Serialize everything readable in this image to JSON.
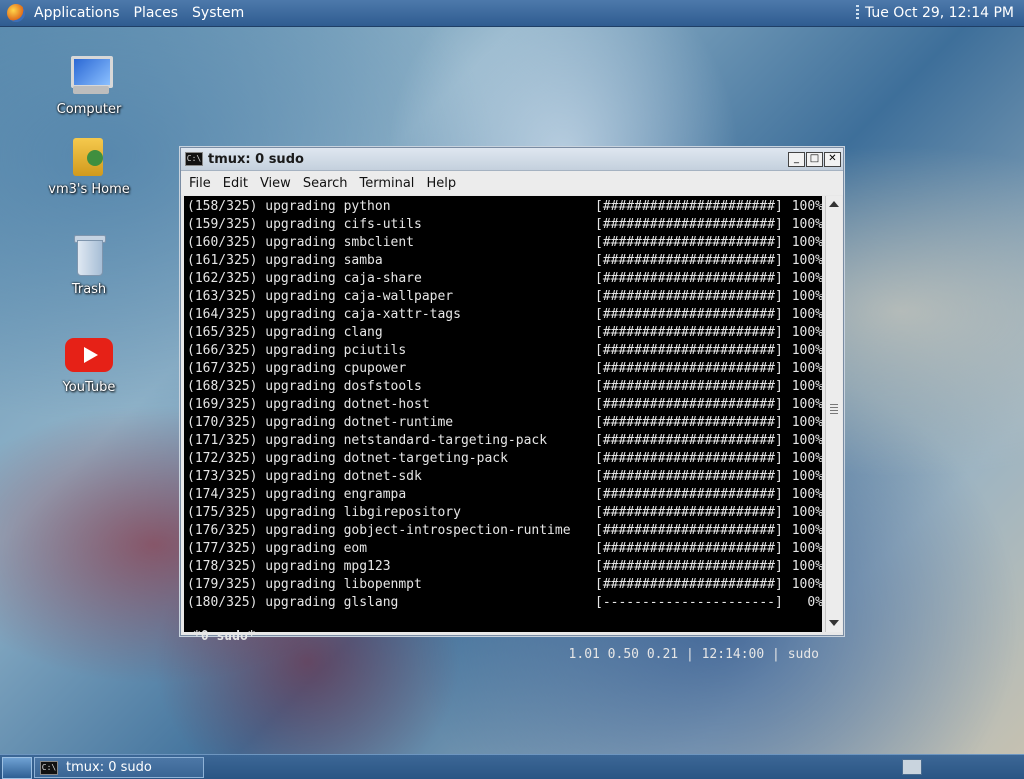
{
  "top_panel": {
    "menus": [
      "Applications",
      "Places",
      "System"
    ],
    "clock": "Tue Oct 29, 12:14 PM"
  },
  "desktop_icons": [
    {
      "label": "Computer",
      "icon": "computer-icon"
    },
    {
      "label": "vm3's Home",
      "icon": "home-folder-icon"
    },
    {
      "label": "Trash",
      "icon": "trash-icon"
    },
    {
      "label": "YouTube",
      "icon": "youtube-icon"
    }
  ],
  "window": {
    "title": "tmux: 0 sudo",
    "controls": [
      "minimize",
      "maximize",
      "close"
    ],
    "menu": [
      "File",
      "Edit",
      "View",
      "Search",
      "Terminal",
      "Help"
    ]
  },
  "terminal": {
    "lines": [
      {
        "counter": "(158/325)",
        "action": "upgrading",
        "pkg": "python",
        "bar": "[######################]",
        "pct": "100%"
      },
      {
        "counter": "(159/325)",
        "action": "upgrading",
        "pkg": "cifs-utils",
        "bar": "[######################]",
        "pct": "100%"
      },
      {
        "counter": "(160/325)",
        "action": "upgrading",
        "pkg": "smbclient",
        "bar": "[######################]",
        "pct": "100%"
      },
      {
        "counter": "(161/325)",
        "action": "upgrading",
        "pkg": "samba",
        "bar": "[######################]",
        "pct": "100%"
      },
      {
        "counter": "(162/325)",
        "action": "upgrading",
        "pkg": "caja-share",
        "bar": "[######################]",
        "pct": "100%"
      },
      {
        "counter": "(163/325)",
        "action": "upgrading",
        "pkg": "caja-wallpaper",
        "bar": "[######################]",
        "pct": "100%"
      },
      {
        "counter": "(164/325)",
        "action": "upgrading",
        "pkg": "caja-xattr-tags",
        "bar": "[######################]",
        "pct": "100%"
      },
      {
        "counter": "(165/325)",
        "action": "upgrading",
        "pkg": "clang",
        "bar": "[######################]",
        "pct": "100%"
      },
      {
        "counter": "(166/325)",
        "action": "upgrading",
        "pkg": "pciutils",
        "bar": "[######################]",
        "pct": "100%"
      },
      {
        "counter": "(167/325)",
        "action": "upgrading",
        "pkg": "cpupower",
        "bar": "[######################]",
        "pct": "100%"
      },
      {
        "counter": "(168/325)",
        "action": "upgrading",
        "pkg": "dosfstools",
        "bar": "[######################]",
        "pct": "100%"
      },
      {
        "counter": "(169/325)",
        "action": "upgrading",
        "pkg": "dotnet-host",
        "bar": "[######################]",
        "pct": "100%"
      },
      {
        "counter": "(170/325)",
        "action": "upgrading",
        "pkg": "dotnet-runtime",
        "bar": "[######################]",
        "pct": "100%"
      },
      {
        "counter": "(171/325)",
        "action": "upgrading",
        "pkg": "netstandard-targeting-pack",
        "bar": "[######################]",
        "pct": "100%"
      },
      {
        "counter": "(172/325)",
        "action": "upgrading",
        "pkg": "dotnet-targeting-pack",
        "bar": "[######################]",
        "pct": "100%"
      },
      {
        "counter": "(173/325)",
        "action": "upgrading",
        "pkg": "dotnet-sdk",
        "bar": "[######################]",
        "pct": "100%"
      },
      {
        "counter": "(174/325)",
        "action": "upgrading",
        "pkg": "engrampa",
        "bar": "[######################]",
        "pct": "100%"
      },
      {
        "counter": "(175/325)",
        "action": "upgrading",
        "pkg": "libgirepository",
        "bar": "[######################]",
        "pct": "100%"
      },
      {
        "counter": "(176/325)",
        "action": "upgrading",
        "pkg": "gobject-introspection-runtime",
        "bar": "[######################]",
        "pct": "100%"
      },
      {
        "counter": "(177/325)",
        "action": "upgrading",
        "pkg": "eom",
        "bar": "[######################]",
        "pct": "100%"
      },
      {
        "counter": "(178/325)",
        "action": "upgrading",
        "pkg": "mpg123",
        "bar": "[######################]",
        "pct": "100%"
      },
      {
        "counter": "(179/325)",
        "action": "upgrading",
        "pkg": "libopenmpt",
        "bar": "[######################]",
        "pct": "100%"
      },
      {
        "counter": "(180/325)",
        "action": "upgrading",
        "pkg": "glslang",
        "bar": "[----------------------]",
        "pct": "0%"
      }
    ],
    "status_left": "*0 sudo*",
    "status_right": "1.01 0.50 0.21 | 12:14:00 | sudo"
  },
  "bottom_panel": {
    "task_label": "tmux: 0 sudo"
  },
  "colors": {
    "panel": "#2f5c91",
    "terminal_bg": "#000000",
    "terminal_fg": "#e6e6e6"
  }
}
